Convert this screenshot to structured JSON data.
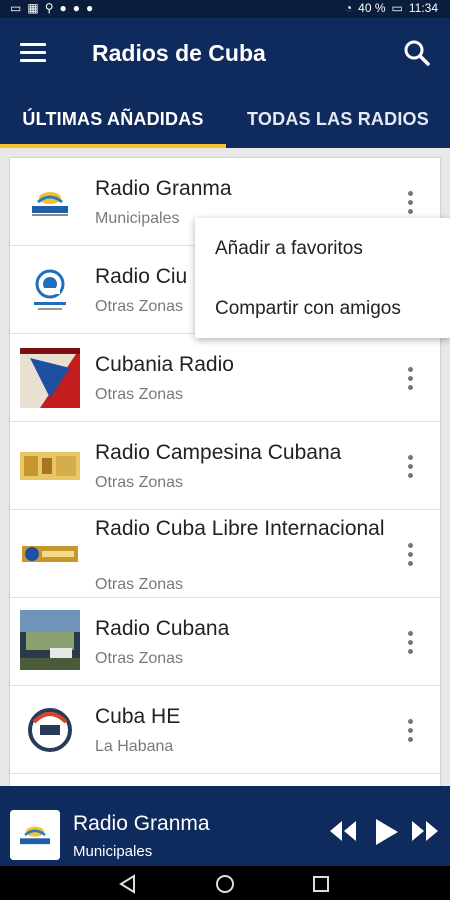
{
  "status": {
    "time": "11:34",
    "battery": "40 %"
  },
  "appbar": {
    "title": "Radios de Cuba"
  },
  "tabs": [
    {
      "label": "ÚLTIMAS AÑADIDAS",
      "active": true
    },
    {
      "label": "TODAS LAS RADIOS",
      "active": false
    }
  ],
  "stations": [
    {
      "title": "Radio Granma",
      "subtitle": "Municipales",
      "logo": "radio-granma-logo"
    },
    {
      "title": "Radio Ciu",
      "subtitle": "Otras Zonas",
      "logo": "radio-ciudad-logo"
    },
    {
      "title": "Cubania Radio",
      "subtitle": "Otras Zonas",
      "logo": "cubania-radio-logo"
    },
    {
      "title": "Radio Campesina Cubana",
      "subtitle": "Otras Zonas",
      "logo": "radio-campesina-logo"
    },
    {
      "title": "Radio Cuba Libre Internacional",
      "subtitle": "Otras Zonas",
      "logo": "radio-cuba-libre-logo"
    },
    {
      "title": "Radio Cubana",
      "subtitle": "Otras Zonas",
      "logo": "radio-cubana-logo"
    },
    {
      "title": "Cuba HE",
      "subtitle": "La Habana",
      "logo": "cuba-he-logo"
    }
  ],
  "popup_menu": {
    "items": [
      "Añadir a favoritos",
      "Compartir con amigos"
    ]
  },
  "player": {
    "title": "Radio Granma",
    "subtitle": "Municipales",
    "state": "paused"
  },
  "colors": {
    "primary": "#0f2a5c",
    "accent": "#f2c230",
    "statusbar": "#0b1d3d"
  }
}
